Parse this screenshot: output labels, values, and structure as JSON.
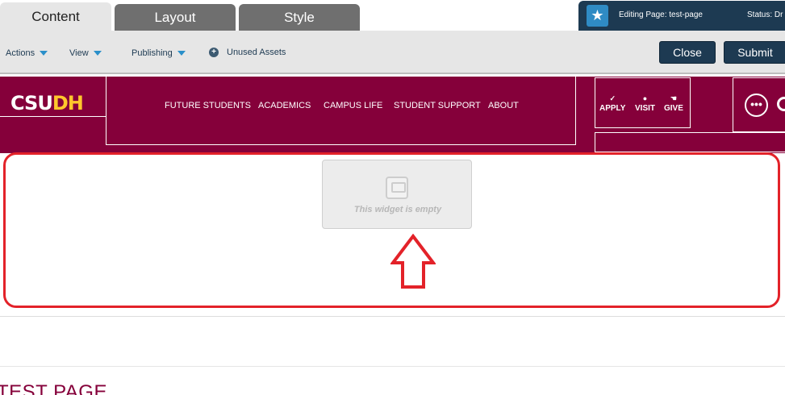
{
  "tabs": {
    "content": "Content",
    "layout": "Layout",
    "style": "Style"
  },
  "status": {
    "editing_label": "Editing Page:  test-page",
    "status_label": "Status: Dr",
    "icon": "star-icon"
  },
  "toolbar": {
    "actions": "Actions",
    "view": "View",
    "publishing": "Publishing",
    "unused_assets": "Unused Assets",
    "close": "Close",
    "submit": "Submit"
  },
  "site": {
    "logo_csu": "CSU",
    "logo_dh": "DH",
    "nav": [
      "FUTURE STUDENTS",
      "ACADEMICS",
      "CAMPUS LIFE",
      "STUDENT SUPPORT",
      "ABOUT"
    ],
    "quick_links": [
      {
        "label": "APPLY",
        "icon": "checkmark-icon"
      },
      {
        "label": "VISIT",
        "icon": "map-pin-icon"
      },
      {
        "label": "GIVE",
        "icon": "hand-icon"
      }
    ],
    "more_icon": "more-icon",
    "search_icon": "search-icon"
  },
  "widget": {
    "empty_text": "This widget is empty"
  },
  "page": {
    "heading": "TEST PAGE"
  },
  "colors": {
    "brand": "#85003a",
    "gold": "#ffc72c",
    "navy": "#1d3a52",
    "highlight": "#e32229"
  }
}
